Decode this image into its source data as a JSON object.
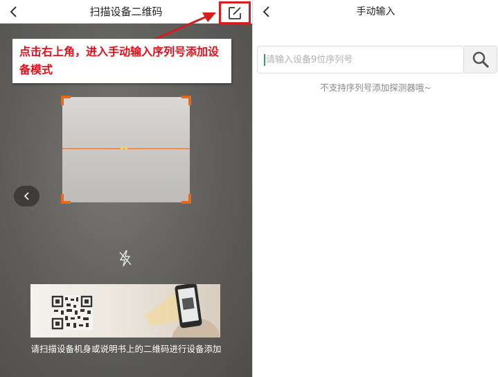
{
  "left": {
    "title": "扫描设备二维码",
    "callout": "点击右上角，进入手动输入序列号添加设备模式",
    "guide_text": "请扫描设备机身或说明书上的二维码进行设备添加",
    "icons": {
      "back": "chevron-left-icon",
      "edit": "edit-square-icon",
      "side_back": "chevron-left-icon",
      "flash": "flash-off-icon",
      "qr": "qr-code-icon",
      "phone": "phone-icon"
    }
  },
  "right": {
    "title": "手动输入",
    "search": {
      "placeholder": "请输入设备9位序列号",
      "value": ""
    },
    "hint": "不支持序列号添加探测器哦~",
    "icons": {
      "back": "chevron-left-icon",
      "search": "search-icon"
    }
  },
  "colors": {
    "callout_text": "#e0101a",
    "highlight_border": "#d61c1c",
    "scan_corner": "#e56a1f",
    "camera_bg": "#5d5c59"
  }
}
